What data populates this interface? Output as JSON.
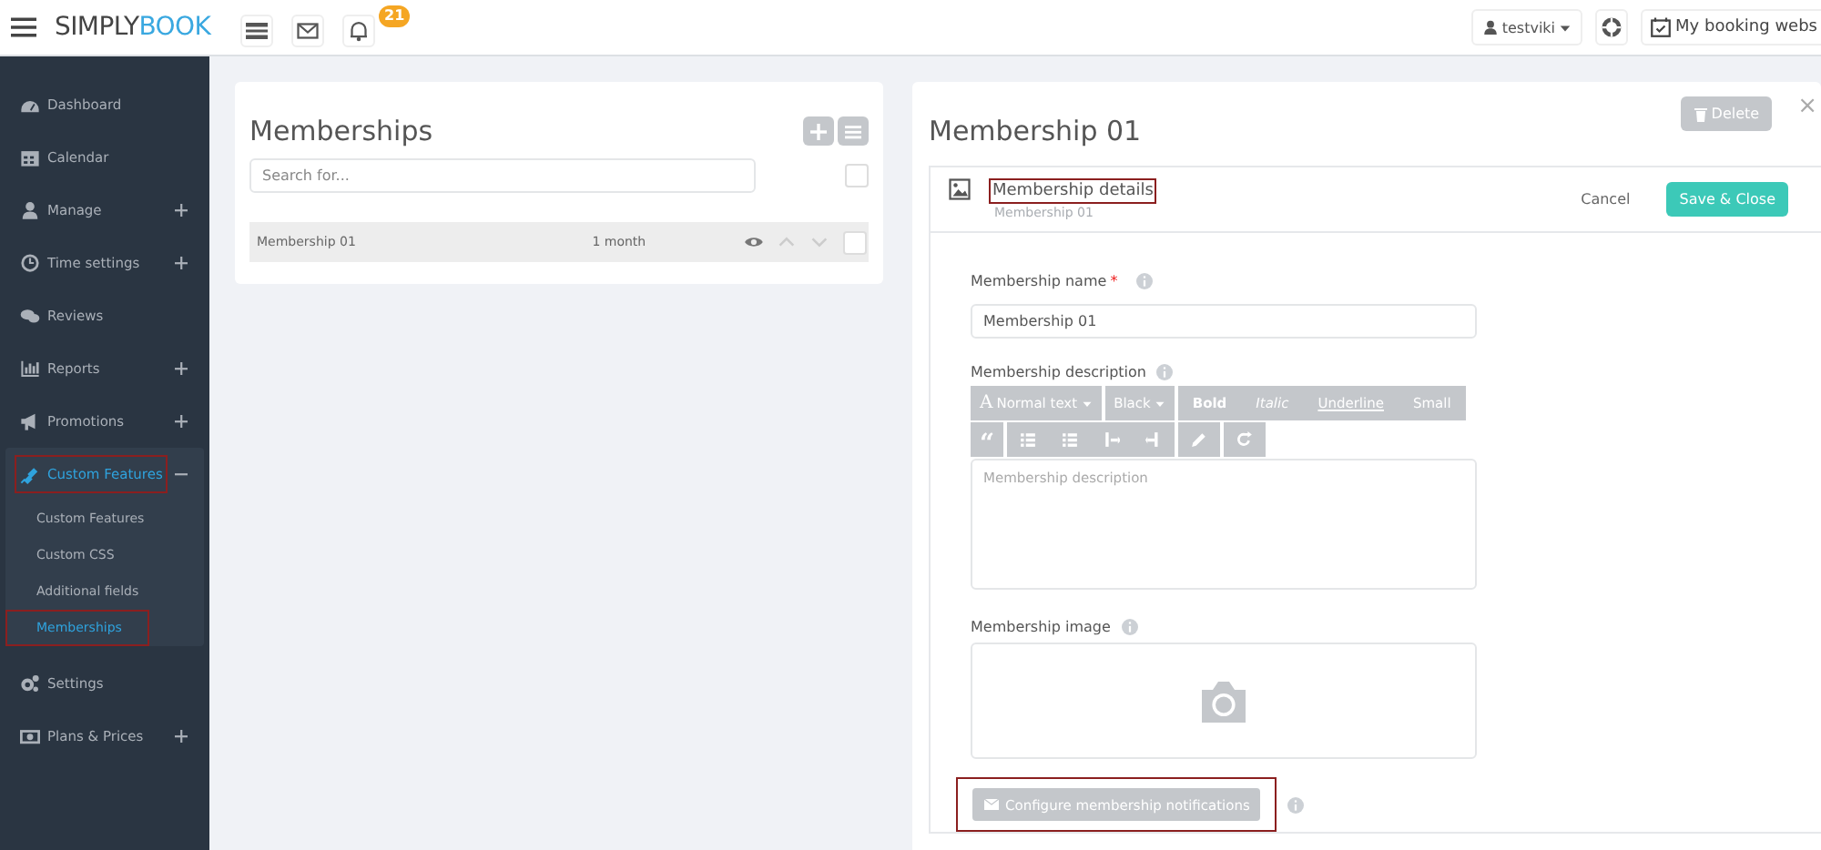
{
  "topbar": {
    "logo": {
      "first": "SIMPLY",
      "second": "BOOK"
    },
    "notification_count": "21",
    "user": "testviki",
    "booking_site": "My booking webs"
  },
  "sidebar": {
    "items": [
      {
        "label": "Dashboard",
        "expandable": false,
        "expanded": false,
        "selected": false,
        "highlighted": false
      },
      {
        "label": "Calendar",
        "expandable": false,
        "expanded": false,
        "selected": false,
        "highlighted": false
      },
      {
        "label": "Manage",
        "expandable": true,
        "expanded": false,
        "selected": false,
        "highlighted": false
      },
      {
        "label": "Time settings",
        "expandable": true,
        "expanded": false,
        "selected": false,
        "highlighted": false
      },
      {
        "label": "Reviews",
        "expandable": false,
        "expanded": false,
        "selected": false,
        "highlighted": false
      },
      {
        "label": "Reports",
        "expandable": true,
        "expanded": false,
        "selected": false,
        "highlighted": false
      },
      {
        "label": "Promotions",
        "expandable": true,
        "expanded": false,
        "selected": false,
        "highlighted": false
      },
      {
        "label": "Custom Features",
        "expandable": true,
        "expanded": true,
        "selected": true,
        "highlighted": true,
        "children": [
          {
            "label": "Custom Features",
            "selected": false,
            "highlighted": false
          },
          {
            "label": "Custom CSS",
            "selected": false,
            "highlighted": false
          },
          {
            "label": "Additional fields",
            "selected": false,
            "highlighted": false
          },
          {
            "label": "Memberships",
            "selected": true,
            "highlighted": true
          }
        ]
      },
      {
        "label": "Settings",
        "expandable": false,
        "expanded": false,
        "selected": false,
        "highlighted": false
      },
      {
        "label": "Plans & Prices",
        "expandable": true,
        "expanded": false,
        "selected": false,
        "highlighted": false
      }
    ]
  },
  "list_panel": {
    "title": "Memberships",
    "search": {
      "placeholder": "Search for..."
    },
    "select_all_checked": false,
    "rows": [
      {
        "name": "Membership 01",
        "duration": "1 month",
        "checked": false
      }
    ]
  },
  "detail_panel": {
    "title": "Membership 01",
    "delete_button": "Delete",
    "close": "×",
    "section": {
      "title": "Membership details",
      "subtitle": "Membership 01",
      "highlighted": true
    },
    "cancel": "Cancel",
    "save": "Save & Close",
    "name_field": {
      "label": "Membership name",
      "required_mark": "*",
      "value": "Membership 01"
    },
    "description_field": {
      "label": "Membership description",
      "placeholder": "Membership description",
      "toolbar": {
        "style_glyph": "A",
        "style_menu": "Normal text",
        "color_menu": "Black",
        "format_buttons": [
          "Bold",
          "Italic",
          "Underline",
          "Small"
        ],
        "quote": "“"
      }
    },
    "image_field": {
      "label": "Membership image"
    },
    "notifications_button": {
      "label": "Configure membership notifications",
      "highlighted": true
    }
  }
}
